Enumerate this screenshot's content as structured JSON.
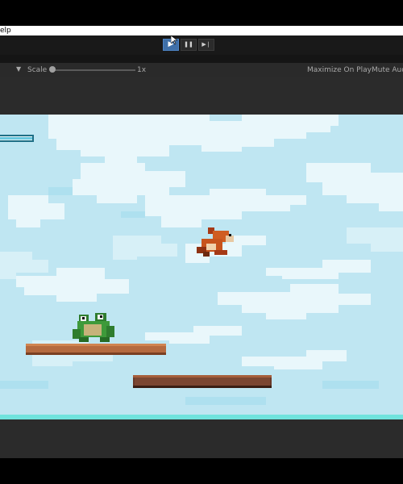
{
  "menu": {
    "help_label": "elp"
  },
  "toolbar": {
    "play_icon": "play-icon",
    "pause_icon": "pause-icon",
    "step_icon": "step-icon",
    "play_symbol": "▶",
    "pause_symbol": "❚❚",
    "step_symbol": "▶❘",
    "accent_color": "#3f6fa8"
  },
  "game_view": {
    "dropdown_symbol": "▼",
    "scale_label": "Scale",
    "scale_value": "1x",
    "scale_fraction": 0.0,
    "maximize_label": "Maximize On Play",
    "mute_label": "Mute Audio"
  },
  "game": {
    "sky_color": "#bfe6f2",
    "cloud_color": "#e9f7fb",
    "player_health_fraction": 1.0,
    "characters": [
      "frog-enemy",
      "fox-player"
    ],
    "platforms": [
      "dirt-platform-upper",
      "dirt-platform-lower"
    ]
  }
}
